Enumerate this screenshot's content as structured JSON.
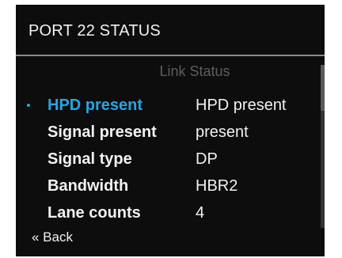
{
  "header": {
    "title": "PORT 22 STATUS"
  },
  "section": {
    "heading": "Link Status"
  },
  "rows": [
    {
      "label": "HPD present",
      "value": "HPD present",
      "selected": true
    },
    {
      "label": "Signal present",
      "value": "present",
      "selected": false
    },
    {
      "label": "Signal type",
      "value": "DP",
      "selected": false
    },
    {
      "label": "Bandwidth",
      "value": "HBR2",
      "selected": false
    },
    {
      "label": "Lane counts",
      "value": "4",
      "selected": false
    }
  ],
  "footer": {
    "back_label": "« Back"
  },
  "colors": {
    "background": "#0d0d0d",
    "text": "#f2f2f2",
    "accent": "#27a6e5",
    "muted": "#5e5e5e",
    "rule": "#8a8a8a"
  }
}
